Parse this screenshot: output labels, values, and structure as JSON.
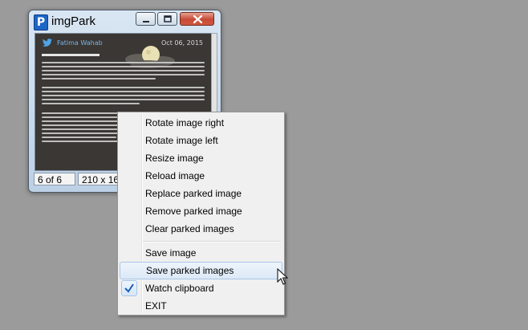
{
  "window": {
    "title": "imgPark",
    "app_icon_letter": "P",
    "status": {
      "count": "6 of 6",
      "size": "210 x 164"
    }
  },
  "tweet": {
    "handle": "Fatima Wahab",
    "date": "Oct 06, 2015"
  },
  "context_menu": {
    "items": [
      {
        "label": "Rotate image right"
      },
      {
        "label": "Rotate image left"
      },
      {
        "label": "Resize image"
      },
      {
        "label": "Reload image"
      },
      {
        "label": "Replace parked image"
      },
      {
        "label": "Remove parked image"
      },
      {
        "label": "Clear parked images"
      },
      {
        "label": "Save image"
      },
      {
        "label": "Save parked images",
        "highlighted": true
      },
      {
        "label": "Watch clipboard",
        "checked": true
      },
      {
        "label": "EXIT"
      }
    ]
  },
  "colors": {
    "desktop": "#9b9b9b",
    "menu_bg": "#f0f0f0",
    "highlight_border": "#a9c6e8",
    "check": "#1a5fb4",
    "close_button": "#c74a35"
  }
}
